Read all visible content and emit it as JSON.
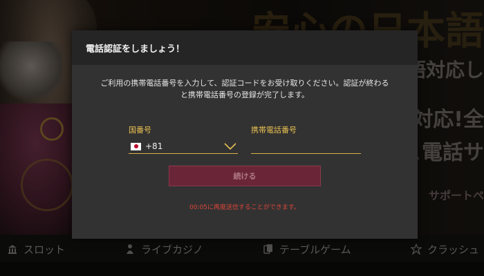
{
  "background": {
    "banner_lines": [
      "安心の日本語",
      "語対応し",
      "対応!全",
      "こ電話サ",
      "サポートペ"
    ]
  },
  "nav": {
    "items": [
      {
        "label": "スロット",
        "icon": "building-icon"
      },
      {
        "label": "ライブカジノ",
        "icon": "dealer-icon"
      },
      {
        "label": "テーブルゲーム",
        "icon": "cards-icon"
      },
      {
        "label": "クラッシュ",
        "icon": "crash-icon"
      }
    ]
  },
  "modal": {
    "title": "電話認証をしましょう！",
    "description": "ご利用の携帯電話番号を入力して、認証コードをお受け取りください。認証が終わると携帯電話番号の登録が完了します。",
    "country_label": "国番号",
    "country_code": "+81",
    "country_flag": "japan-flag-icon",
    "phone_label": "携帯電話番号",
    "phone_value": "",
    "continue_label": "続ける",
    "resend_note": "00:05に再度送信することができます。"
  },
  "colors": {
    "accent_gold": "#e7c052",
    "button_bg": "#6a2637",
    "warning_red": "#d9453a"
  }
}
